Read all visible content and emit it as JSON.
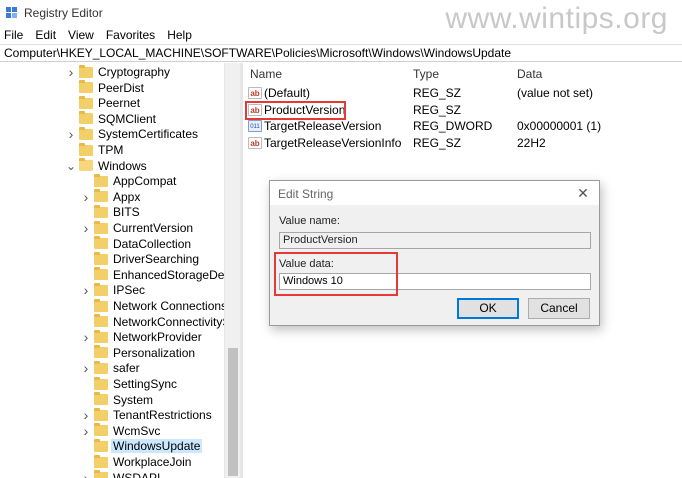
{
  "window": {
    "title": "Registry Editor",
    "watermark": "www.wintips.org"
  },
  "menu": [
    "File",
    "Edit",
    "View",
    "Favorites",
    "Help"
  ],
  "address": "Computer\\HKEY_LOCAL_MACHINE\\SOFTWARE\\Policies\\Microsoft\\Windows\\WindowsUpdate",
  "tree": [
    {
      "label": "Cryptography",
      "depth": 0,
      "expander": "collapsed"
    },
    {
      "label": "PeerDist",
      "depth": 0,
      "expander": "none"
    },
    {
      "label": "Peernet",
      "depth": 0,
      "expander": "none"
    },
    {
      "label": "SQMClient",
      "depth": 0,
      "expander": "none"
    },
    {
      "label": "SystemCertificates",
      "depth": 0,
      "expander": "collapsed"
    },
    {
      "label": "TPM",
      "depth": 0,
      "expander": "none"
    },
    {
      "label": "Windows",
      "depth": 0,
      "expander": "expanded"
    },
    {
      "label": "AppCompat",
      "depth": 1,
      "expander": "none"
    },
    {
      "label": "Appx",
      "depth": 1,
      "expander": "collapsed"
    },
    {
      "label": "BITS",
      "depth": 1,
      "expander": "none"
    },
    {
      "label": "CurrentVersion",
      "depth": 1,
      "expander": "collapsed"
    },
    {
      "label": "DataCollection",
      "depth": 1,
      "expander": "none"
    },
    {
      "label": "DriverSearching",
      "depth": 1,
      "expander": "none"
    },
    {
      "label": "EnhancedStorageDevices",
      "depth": 1,
      "expander": "none"
    },
    {
      "label": "IPSec",
      "depth": 1,
      "expander": "collapsed"
    },
    {
      "label": "Network Connections",
      "depth": 1,
      "expander": "none"
    },
    {
      "label": "NetworkConnectivityStatusIndicator",
      "depth": 1,
      "expander": "none"
    },
    {
      "label": "NetworkProvider",
      "depth": 1,
      "expander": "collapsed"
    },
    {
      "label": "Personalization",
      "depth": 1,
      "expander": "none"
    },
    {
      "label": "safer",
      "depth": 1,
      "expander": "collapsed"
    },
    {
      "label": "SettingSync",
      "depth": 1,
      "expander": "none"
    },
    {
      "label": "System",
      "depth": 1,
      "expander": "none"
    },
    {
      "label": "TenantRestrictions",
      "depth": 1,
      "expander": "collapsed"
    },
    {
      "label": "WcmSvc",
      "depth": 1,
      "expander": "collapsed"
    },
    {
      "label": "WindowsUpdate",
      "depth": 1,
      "expander": "none",
      "selected": true
    },
    {
      "label": "WorkplaceJoin",
      "depth": 1,
      "expander": "none"
    },
    {
      "label": "WSDAPI",
      "depth": 1,
      "expander": "collapsed"
    }
  ],
  "list": {
    "columns": [
      "Name",
      "Type",
      "Data"
    ],
    "rows": [
      {
        "name": "(Default)",
        "type": "REG_SZ",
        "data": "(value not set)",
        "icon": "sz"
      },
      {
        "name": "ProductVersion",
        "type": "REG_SZ",
        "data": "",
        "icon": "sz",
        "highlighted": true
      },
      {
        "name": "TargetReleaseVersion",
        "type": "REG_DWORD",
        "data": "0x00000001 (1)",
        "icon": "dword"
      },
      {
        "name": "TargetReleaseVersionInfo",
        "type": "REG_SZ",
        "data": "22H2",
        "icon": "sz"
      }
    ]
  },
  "dialog": {
    "title": "Edit String",
    "close_glyph": "✕",
    "value_name_label": "Value name:",
    "value_name": "ProductVersion",
    "value_data_label": "Value data:",
    "value_data": "Windows 10",
    "ok_label": "OK",
    "cancel_label": "Cancel"
  },
  "colors": {
    "highlight_box": "#e53935",
    "selection": "#cce8ff"
  }
}
